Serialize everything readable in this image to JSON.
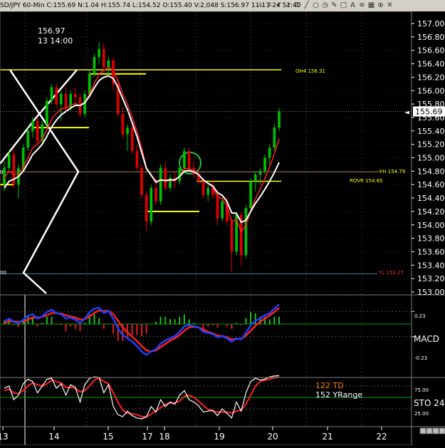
{
  "header": {
    "quote_line": "SD/JPY  60-Min  C:155.69  N:1.04  H:155.74  L:154.52  O:155.40  V:2,048  S:156.97  11-13-24  51:40",
    "icons": [
      "alert-icon",
      "bell-icon",
      "check-icon",
      "arrow-icon",
      "lock-icon",
      "line-icon",
      "circle-icon",
      "clock-icon",
      "pencil-icon",
      "shape-icon",
      "text-icon",
      "fib-icon",
      "grid-icon",
      "zoom-icon",
      "close-icon"
    ]
  },
  "cursor_info": {
    "price": "156.97",
    "time": "13 14:00"
  },
  "price_scale": {
    "ticks": [
      "157.00",
      "156.80",
      "156.60",
      "156.40",
      "156.20",
      "156.00",
      "155.80",
      "155.60",
      "155.40",
      "155.20",
      "155.00",
      "154.80",
      "154.60",
      "154.40",
      "154.20",
      "154.00",
      "153.80",
      "153.60",
      "153.40",
      "153.20",
      "153.00"
    ],
    "last_price": "155.69",
    "left_edge_labels": [
      "0",
      "00"
    ]
  },
  "level_labels": {
    "oh4": "OH4  156.31",
    "yh": "YH  154.79",
    "rovr": "ROVR  154.65",
    "yl": "YL  153.27"
  },
  "macd_panel": {
    "name": "MACD",
    "tick_upper": "0.23",
    "tick_lower": "-0.23"
  },
  "sto_panel": {
    "name": "STO  24",
    "td_label": "122 TD",
    "yrange_label": "152 YRange",
    "tick_upper": "75.00",
    "tick_lower": "25.00"
  },
  "x_axis": {
    "labels": [
      "13",
      "14",
      "15",
      "17",
      "18",
      "19",
      "20",
      "21",
      "22"
    ]
  },
  "colors": {
    "candle_up": "#00c000",
    "candle_down": "#e00000",
    "ema_fast": "#ff2020",
    "ema_slow": "#ffffff",
    "level": "#ffff00",
    "macd_line": "#2040ff",
    "signal_line": "#ff2020",
    "td_label": "#ff8000"
  },
  "chart_data": {
    "type": "candlestick",
    "title": "",
    "ylim": [
      153.0,
      157.0
    ],
    "grid": true,
    "x_categories": [
      "13",
      "14",
      "15",
      "17",
      "18",
      "19",
      "20",
      "21",
      "22"
    ],
    "levels": [
      {
        "name": "OH4",
        "value": 156.31
      },
      {
        "name": "YH",
        "value": 154.79
      },
      {
        "name": "ROVR",
        "value": 154.65
      },
      {
        "name": "YL",
        "value": 153.27
      }
    ],
    "candles": [
      [
        154.6,
        154.95,
        154.5,
        154.85
      ],
      [
        154.85,
        155.1,
        154.8,
        155.05
      ],
      [
        155.05,
        155.15,
        154.55,
        154.6
      ],
      [
        154.6,
        154.9,
        154.4,
        154.85
      ],
      [
        154.85,
        155.2,
        154.8,
        155.15
      ],
      [
        155.15,
        155.45,
        155.1,
        155.4
      ],
      [
        155.4,
        155.6,
        155.3,
        155.55
      ],
      [
        155.55,
        155.6,
        155.2,
        155.25
      ],
      [
        155.25,
        155.55,
        155.2,
        155.5
      ],
      [
        155.5,
        155.9,
        155.45,
        155.85
      ],
      [
        155.85,
        156.1,
        155.8,
        156.05
      ],
      [
        156.05,
        156.1,
        155.75,
        155.8
      ],
      [
        155.8,
        156.0,
        155.55,
        155.95
      ],
      [
        155.95,
        156.05,
        155.7,
        155.75
      ],
      [
        155.75,
        156.0,
        155.7,
        155.95
      ],
      [
        155.95,
        156.05,
        155.8,
        155.9
      ],
      [
        155.9,
        155.95,
        155.6,
        155.65
      ],
      [
        155.65,
        156.0,
        155.6,
        155.95
      ],
      [
        155.95,
        156.3,
        155.9,
        156.25
      ],
      [
        156.25,
        156.55,
        156.2,
        156.5
      ],
      [
        156.5,
        156.72,
        156.4,
        156.62
      ],
      [
        156.62,
        156.7,
        156.3,
        156.35
      ],
      [
        156.35,
        156.5,
        156.25,
        156.45
      ],
      [
        156.45,
        156.5,
        156.0,
        156.1
      ],
      [
        156.1,
        156.15,
        155.6,
        155.65
      ],
      [
        155.65,
        155.75,
        155.3,
        155.35
      ],
      [
        155.35,
        155.5,
        155.1,
        155.45
      ],
      [
        155.45,
        155.5,
        155.05,
        155.1
      ],
      [
        155.1,
        155.2,
        154.8,
        154.85
      ],
      [
        154.85,
        154.9,
        154.4,
        154.45
      ],
      [
        154.45,
        154.5,
        153.9,
        154.05
      ],
      [
        154.05,
        154.6,
        154.0,
        154.55
      ],
      [
        154.55,
        154.7,
        154.3,
        154.35
      ],
      [
        154.35,
        154.9,
        154.3,
        154.85
      ],
      [
        154.85,
        154.95,
        154.5,
        154.55
      ],
      [
        154.55,
        154.75,
        154.5,
        154.7
      ],
      [
        154.7,
        154.8,
        154.55,
        154.65
      ],
      [
        154.65,
        154.9,
        154.6,
        154.85
      ],
      [
        154.85,
        155.15,
        154.8,
        155.1
      ],
      [
        155.1,
        155.15,
        154.8,
        154.85
      ],
      [
        154.85,
        154.95,
        154.7,
        154.75
      ],
      [
        154.75,
        154.85,
        154.6,
        154.65
      ],
      [
        154.65,
        154.7,
        154.4,
        154.45
      ],
      [
        154.45,
        154.6,
        154.35,
        154.55
      ],
      [
        154.55,
        154.65,
        154.4,
        154.45
      ],
      [
        154.45,
        154.5,
        154.0,
        154.1
      ],
      [
        154.1,
        154.4,
        154.05,
        154.35
      ],
      [
        154.35,
        154.4,
        154.0,
        154.05
      ],
      [
        154.05,
        154.1,
        153.3,
        153.6
      ],
      [
        153.6,
        154.2,
        153.55,
        154.15
      ],
      [
        154.15,
        154.2,
        153.4,
        153.55
      ],
      [
        153.55,
        154.3,
        153.5,
        154.25
      ],
      [
        154.25,
        154.7,
        154.2,
        154.65
      ],
      [
        154.65,
        154.8,
        154.5,
        154.75
      ],
      [
        154.75,
        154.85,
        154.6,
        154.8
      ],
      [
        154.8,
        155.05,
        154.75,
        155.0
      ],
      [
        155.0,
        155.2,
        154.9,
        155.15
      ],
      [
        155.15,
        155.5,
        155.1,
        155.45
      ],
      [
        155.45,
        155.74,
        155.4,
        155.69
      ]
    ],
    "series": [
      {
        "name": "ema-fast",
        "values": [
          154.7,
          154.8,
          154.75,
          154.76,
          154.86,
          155.0,
          155.15,
          155.2,
          155.28,
          155.42,
          155.58,
          155.66,
          155.73,
          155.74,
          155.78,
          155.81,
          155.77,
          155.82,
          155.95,
          156.1,
          156.25,
          156.3,
          156.35,
          156.3,
          156.15,
          155.95,
          155.8,
          155.6,
          155.4,
          155.15,
          154.85,
          154.75,
          154.62,
          154.68,
          154.65,
          154.66,
          154.66,
          154.72,
          154.84,
          154.84,
          154.81,
          154.76,
          154.66,
          154.62,
          154.56,
          154.42,
          154.39,
          154.28,
          154.05,
          154.08,
          153.9,
          153.99,
          154.21,
          154.39,
          154.53,
          154.69,
          154.86,
          155.06,
          155.28
        ]
      },
      {
        "name": "ema-slow",
        "values": [
          154.55,
          154.65,
          154.68,
          154.72,
          154.8,
          154.92,
          155.05,
          155.12,
          155.2,
          155.32,
          155.46,
          155.56,
          155.64,
          155.69,
          155.74,
          155.78,
          155.78,
          155.82,
          155.92,
          156.04,
          156.15,
          156.2,
          156.22,
          156.18,
          156.05,
          155.88,
          155.72,
          155.52,
          155.32,
          155.08,
          154.84,
          154.74,
          154.64,
          154.67,
          154.66,
          154.67,
          154.67,
          154.72,
          154.8,
          154.81,
          154.79,
          154.75,
          154.67,
          154.62,
          154.58,
          154.48,
          154.44,
          154.35,
          154.18,
          154.17,
          154.04,
          154.07,
          154.2,
          154.32,
          154.42,
          154.53,
          154.65,
          154.78,
          154.93
        ]
      }
    ],
    "macd": {
      "zero_ticks": [
        "0.23",
        "-0.23"
      ],
      "macd_line": [
        0.05,
        0.1,
        0.04,
        0.02,
        0.08,
        0.15,
        0.18,
        0.1,
        0.14,
        0.22,
        0.26,
        0.2,
        0.18,
        0.1,
        0.12,
        0.08,
        0.02,
        0.1,
        0.22,
        0.28,
        0.3,
        0.2,
        0.24,
        0.1,
        -0.08,
        -0.2,
        -0.26,
        -0.32,
        -0.4,
        -0.5,
        -0.56,
        -0.5,
        -0.46,
        -0.36,
        -0.3,
        -0.26,
        -0.22,
        -0.14,
        -0.04,
        -0.02,
        -0.04,
        -0.06,
        -0.14,
        -0.16,
        -0.18,
        -0.24,
        -0.22,
        -0.26,
        -0.32,
        -0.26,
        -0.28,
        -0.16,
        -0.02,
        0.06,
        0.1,
        0.16,
        0.2,
        0.28,
        0.36
      ],
      "signal_line": [
        0.02,
        0.05,
        0.05,
        0.04,
        0.05,
        0.08,
        0.12,
        0.12,
        0.13,
        0.16,
        0.2,
        0.2,
        0.19,
        0.16,
        0.14,
        0.12,
        0.08,
        0.09,
        0.14,
        0.2,
        0.25,
        0.24,
        0.24,
        0.18,
        0.06,
        -0.06,
        -0.15,
        -0.23,
        -0.31,
        -0.4,
        -0.48,
        -0.5,
        -0.48,
        -0.42,
        -0.36,
        -0.3,
        -0.26,
        -0.2,
        -0.12,
        -0.06,
        -0.05,
        -0.06,
        -0.1,
        -0.14,
        -0.17,
        -0.21,
        -0.22,
        -0.24,
        -0.28,
        -0.27,
        -0.27,
        -0.21,
        -0.12,
        -0.03,
        0.04,
        0.1,
        0.16,
        0.22,
        0.3
      ]
    },
    "stochastic": {
      "ylim": [
        0,
        100
      ],
      "ticks": [
        75,
        25
      ],
      "k": [
        70,
        75,
        45,
        55,
        80,
        90,
        85,
        60,
        75,
        90,
        92,
        70,
        80,
        55,
        78,
        72,
        40,
        78,
        92,
        95,
        94,
        60,
        78,
        30,
        12,
        8,
        20,
        10,
        5,
        3,
        8,
        30,
        18,
        45,
        30,
        40,
        35,
        55,
        65,
        45,
        40,
        32,
        18,
        20,
        22,
        10,
        25,
        15,
        5,
        40,
        20,
        60,
        85,
        92,
        88,
        90,
        95,
        97,
        98
      ],
      "d": [
        65,
        68,
        60,
        58,
        65,
        75,
        82,
        78,
        75,
        80,
        88,
        85,
        82,
        72,
        72,
        70,
        62,
        65,
        75,
        88,
        92,
        85,
        80,
        60,
        40,
        22,
        15,
        14,
        12,
        8,
        7,
        14,
        20,
        28,
        35,
        38,
        38,
        42,
        52,
        55,
        50,
        42,
        32,
        24,
        20,
        18,
        18,
        18,
        16,
        20,
        22,
        35,
        55,
        75,
        85,
        88,
        90,
        93,
        95
      ]
    }
  }
}
